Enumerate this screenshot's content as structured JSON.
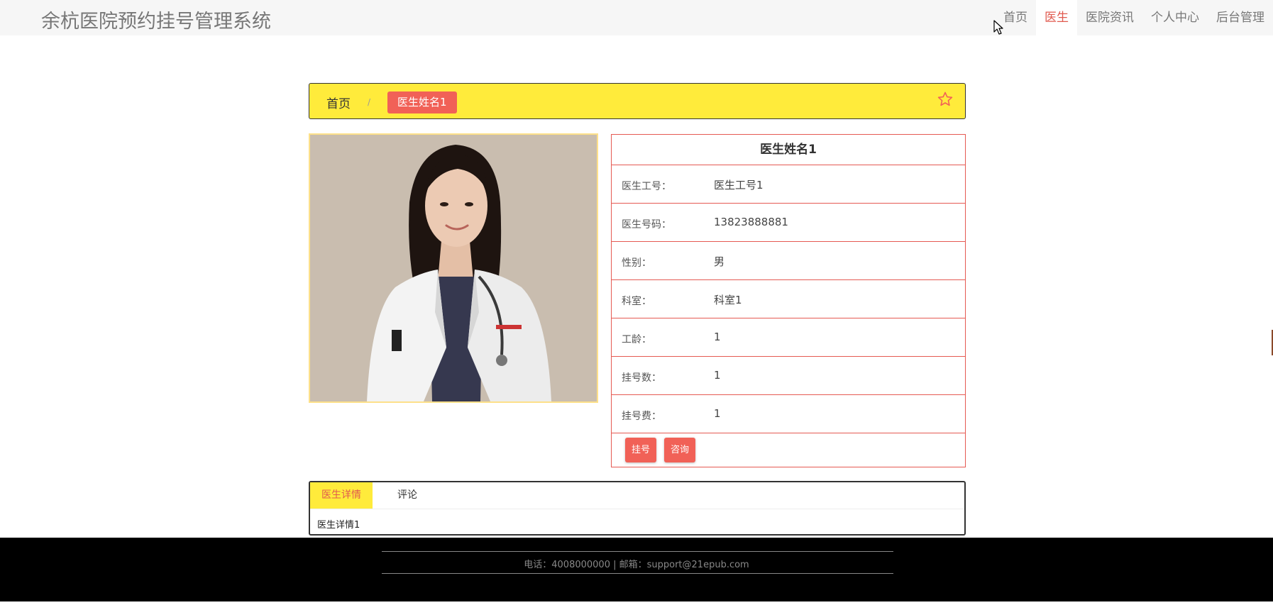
{
  "app": {
    "title": "余杭医院预约挂号管理系统"
  },
  "nav": {
    "items": [
      {
        "label": "首页"
      },
      {
        "label": "医生"
      },
      {
        "label": "医院资讯"
      },
      {
        "label": "个人中心"
      },
      {
        "label": "后台管理"
      }
    ],
    "active_index": 1
  },
  "breadcrumb": {
    "home": "首页",
    "separator": "/",
    "current": "医生姓名1"
  },
  "doctor": {
    "name": "医生姓名1",
    "fields": [
      {
        "label": "医生工号：",
        "value": "医生工号1"
      },
      {
        "label": "医生号码：",
        "value": "13823888881"
      },
      {
        "label": "性别：",
        "value": "男"
      },
      {
        "label": "科室：",
        "value": "科室1"
      },
      {
        "label": "工龄：",
        "value": "1"
      },
      {
        "label": "挂号数：",
        "value": "1"
      },
      {
        "label": "挂号费：",
        "value": "1"
      }
    ],
    "actions": {
      "register": "挂号",
      "consult": "咨询"
    }
  },
  "tabs": {
    "items": [
      {
        "label": "医生详情"
      },
      {
        "label": "评论"
      }
    ],
    "content": "医生详情1"
  },
  "footer": {
    "text": "电话：4008000000 | 邮箱：support@21epub.com"
  },
  "colors": {
    "accent_red": "#f16157",
    "accent_yellow": "#ffeb3b",
    "border_red": "#e55a52",
    "footer_bg": "#000000"
  },
  "icons": {
    "favorite": "star-outline-icon",
    "cursor": "mouse-pointer-icon"
  }
}
